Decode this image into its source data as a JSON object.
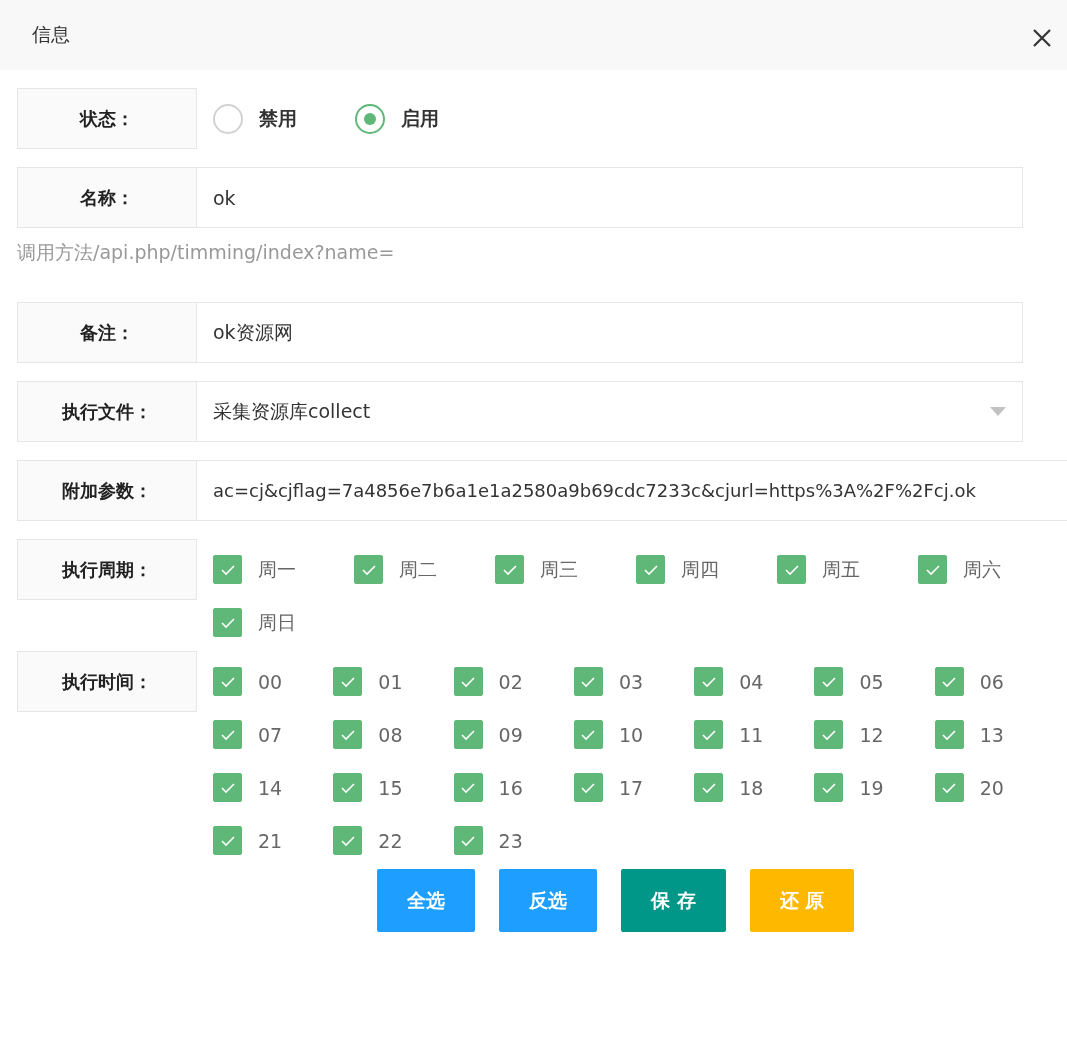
{
  "dialog": {
    "title": "信息"
  },
  "status": {
    "label": "状态：",
    "options": [
      {
        "label": "禁用",
        "selected": false
      },
      {
        "label": "启用",
        "selected": true
      }
    ]
  },
  "name": {
    "label": "名称：",
    "value": "ok"
  },
  "hint": "调用方法/api.php/timming/index?name=",
  "remark": {
    "label": "备注：",
    "value": "ok资源网"
  },
  "file": {
    "label": "执行文件：",
    "value": "采集资源库collect"
  },
  "params": {
    "label": "附加参数：",
    "value": "ac=cj&cjflag=7a4856e7b6a1e1a2580a9b69cdc7233c&cjurl=https%3A%2F%2Fcj.ok"
  },
  "weekdays": {
    "label": "执行周期：",
    "items": [
      {
        "label": "周一",
        "checked": true
      },
      {
        "label": "周二",
        "checked": true
      },
      {
        "label": "周三",
        "checked": true
      },
      {
        "label": "周四",
        "checked": true
      },
      {
        "label": "周五",
        "checked": true
      },
      {
        "label": "周六",
        "checked": true
      },
      {
        "label": "周日",
        "checked": true
      }
    ]
  },
  "hours": {
    "label": "执行时间：",
    "items": [
      {
        "label": "00",
        "checked": true
      },
      {
        "label": "01",
        "checked": true
      },
      {
        "label": "02",
        "checked": true
      },
      {
        "label": "03",
        "checked": true
      },
      {
        "label": "04",
        "checked": true
      },
      {
        "label": "05",
        "checked": true
      },
      {
        "label": "06",
        "checked": true
      },
      {
        "label": "07",
        "checked": true
      },
      {
        "label": "08",
        "checked": true
      },
      {
        "label": "09",
        "checked": true
      },
      {
        "label": "10",
        "checked": true
      },
      {
        "label": "11",
        "checked": true
      },
      {
        "label": "12",
        "checked": true
      },
      {
        "label": "13",
        "checked": true
      },
      {
        "label": "14",
        "checked": true
      },
      {
        "label": "15",
        "checked": true
      },
      {
        "label": "16",
        "checked": true
      },
      {
        "label": "17",
        "checked": true
      },
      {
        "label": "18",
        "checked": true
      },
      {
        "label": "19",
        "checked": true
      },
      {
        "label": "20",
        "checked": true
      },
      {
        "label": "21",
        "checked": true
      },
      {
        "label": "22",
        "checked": true
      },
      {
        "label": "23",
        "checked": true
      }
    ]
  },
  "buttons": [
    {
      "label": "全选",
      "kind": "primary"
    },
    {
      "label": "反选",
      "kind": "primary"
    },
    {
      "label": "保 存",
      "kind": "teal"
    },
    {
      "label": "还 原",
      "kind": "warm"
    }
  ]
}
